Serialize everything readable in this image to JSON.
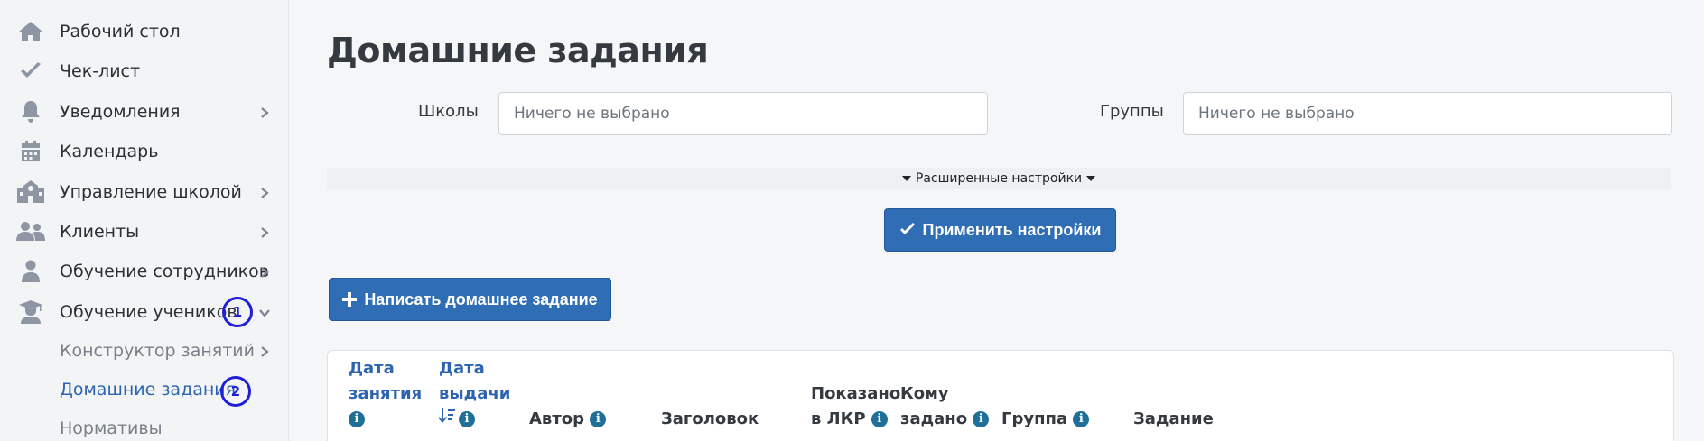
{
  "sidebar": {
    "items": [
      {
        "label": "Рабочий стол",
        "icon": "home-icon"
      },
      {
        "label": "Чек-лист",
        "icon": "check-icon"
      },
      {
        "label": "Уведомления",
        "icon": "bell-icon",
        "chevron": "right"
      },
      {
        "label": "Календарь",
        "icon": "calendar-icon"
      },
      {
        "label": "Управление школой",
        "icon": "school-icon",
        "chevron": "right"
      },
      {
        "label": "Клиенты",
        "icon": "users-icon",
        "chevron": "right"
      },
      {
        "label": "Обучение сотрудников",
        "icon": "staff-icon",
        "chevron": "right"
      },
      {
        "label": "Обучение учеников",
        "icon": "graduate-icon",
        "chevron": "down",
        "marker": "1"
      }
    ],
    "subitems": [
      {
        "label": "Конструктор занятий",
        "chevron": "right"
      },
      {
        "label": "Домашние задания",
        "active": true,
        "marker": "2"
      },
      {
        "label": "Нормативы"
      }
    ]
  },
  "main": {
    "title": "Домашние задания",
    "filters": {
      "schools_label": "Школы",
      "schools_placeholder": "Ничего не выбрано",
      "groups_label": "Группы",
      "groups_placeholder": "Ничего не выбрано"
    },
    "advanced_settings": "Расширенные настройки",
    "apply_button": "Применить настройки",
    "write_button": "Написать домашнее задание",
    "table": {
      "columns": [
        {
          "line1": "Дата",
          "line2": "занятия",
          "info": true,
          "link": true
        },
        {
          "line1": "Дата",
          "line2": "выдачи",
          "info": true,
          "link": true,
          "sort": true
        },
        {
          "line1": "Автор",
          "info": true
        },
        {
          "line1": "Заголовок"
        },
        {
          "line1": "Показано",
          "line2": "в ЛКР",
          "info": true
        },
        {
          "line1": "Кому",
          "line2": "задано",
          "info": true
        },
        {
          "line1": "Группа",
          "info": true
        },
        {
          "line1": "Задание"
        }
      ],
      "info_glyph": "i"
    }
  },
  "colors": {
    "primary": "#2f6db5",
    "link": "#2d64b0",
    "marker": "#1f1fd8",
    "info": "#1f6f98"
  }
}
